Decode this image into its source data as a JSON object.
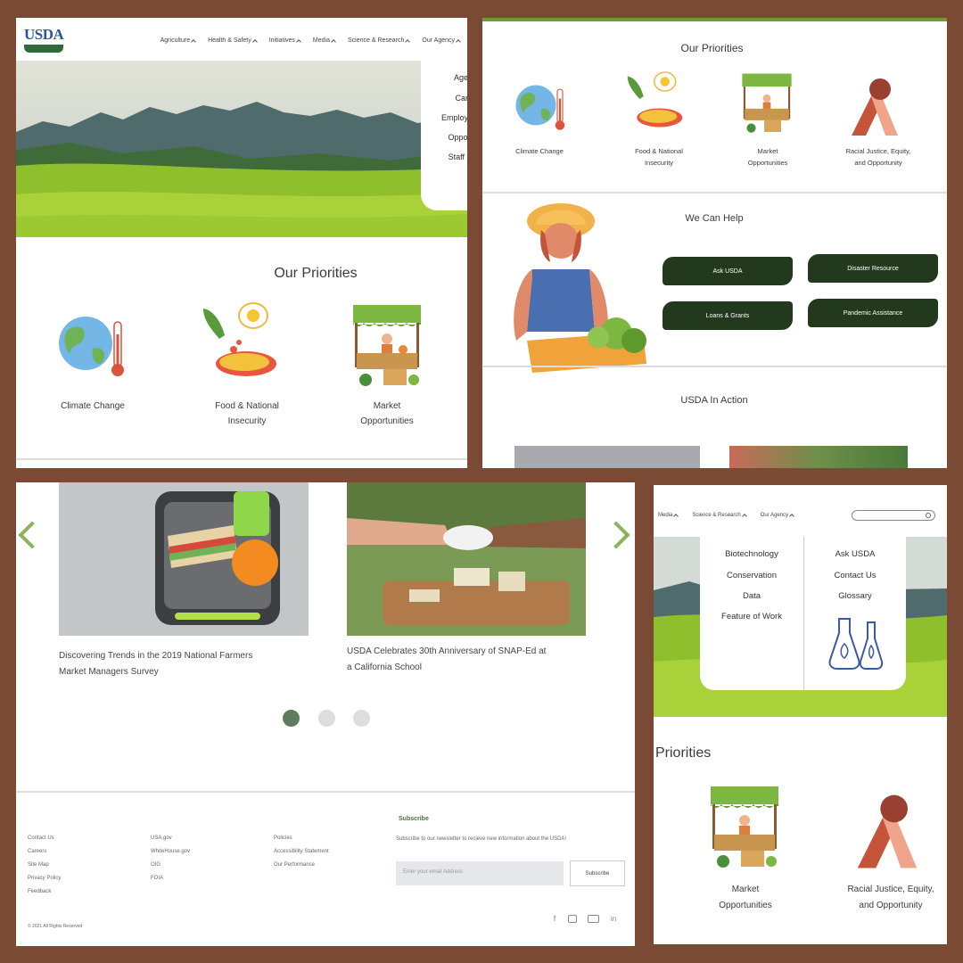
{
  "brand": {
    "logo_text": "USDA"
  },
  "nav": {
    "items": [
      "Agriculture",
      "Health & Safety",
      "Initiatives",
      "Media",
      "Science & Research",
      "Our Agency"
    ]
  },
  "panel1": {
    "agency_dropdown": [
      "Agen",
      "Care",
      "Employe",
      "Opport",
      "Staff D"
    ],
    "priorities_title": "Our Priorities",
    "priorities": [
      {
        "label_l1": "Climate Change",
        "label_l2": "",
        "icon": "globe-thermometer-icon"
      },
      {
        "label_l1": "Food & National",
        "label_l2": "Insecurity",
        "icon": "food-icon"
      },
      {
        "label_l1": "Market",
        "label_l2": "Opportunities",
        "icon": "market-stall-icon"
      }
    ]
  },
  "panel2": {
    "priorities_title": "Our Priorities",
    "priorities": [
      {
        "label_l1": "Climate Change",
        "label_l2": ""
      },
      {
        "label_l1": "Food & National",
        "label_l2": "Insecurity"
      },
      {
        "label_l1": "Market",
        "label_l2": "Opportunities"
      },
      {
        "label_l1": "Racial Justice, Equity,",
        "label_l2": "and Opportunity"
      }
    ],
    "help_title": "We Can Help",
    "help_buttons": [
      "Ask USDA",
      "Disaster Resource",
      "Loans & Grants",
      "Pandemic Assistance"
    ],
    "action_title": "USDA In Action"
  },
  "panel3": {
    "cards": [
      {
        "caption_l1": "Discovering Trends in the 2019 National Farmers",
        "caption_l2": "Market Managers Survey"
      },
      {
        "caption_l1": "USDA Celebrates 30th Anniversary of SNAP-Ed at",
        "caption_l2": "a California School"
      }
    ],
    "footer": {
      "col1": [
        "Contact Us",
        "Careers",
        "Site Map",
        "Privacy Policy",
        "Feedback"
      ],
      "col2": [
        "USA.gov",
        "WhiteHouse.gov",
        "OIG",
        "FOIA"
      ],
      "col3": [
        "Policies",
        "Accessibility Statement",
        "Our Performance"
      ],
      "subscribe_title": "Subscribe",
      "subscribe_text": "Subscribe to our newsletter to recieve new information about the USDA!",
      "email_placeholder": "Enter your email Address",
      "subscribe_button": "Subscribe",
      "copyright": "© 2021 All Rights Reserved"
    }
  },
  "panel4": {
    "nav": [
      "Media",
      "Science & Research",
      "Our Agency"
    ],
    "mega_left": [
      "Biotechnology",
      "Conservation",
      "Data",
      "Feature of Work"
    ],
    "mega_right": [
      "Ask USDA",
      "Contact Us",
      "Glossary"
    ],
    "priorities_title": "Priorities",
    "priorities": [
      {
        "label_l1": "Market",
        "label_l2": "Opportunities"
      },
      {
        "label_l1": "Racial Justice, Equity,",
        "label_l2": "and Opportunity"
      }
    ]
  },
  "colors": {
    "dark_green": "#22391e",
    "accent_green": "#8db35a",
    "frame_brown": "#7a4a34",
    "usda_blue": "#2d5596"
  }
}
